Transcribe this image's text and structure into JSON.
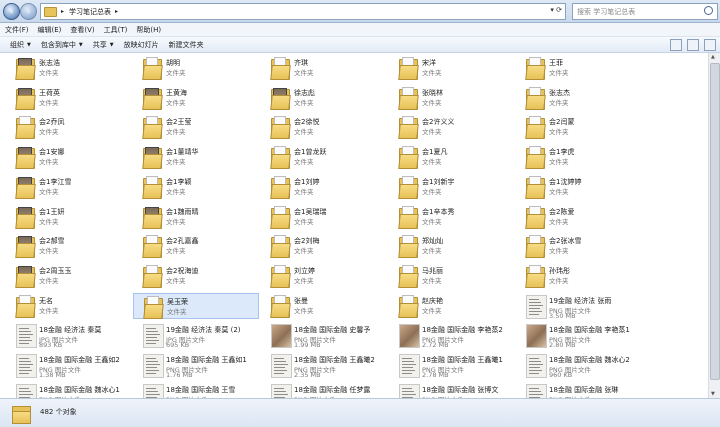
{
  "address": {
    "path": [
      "学习笔记总表"
    ],
    "search_placeholder": "搜索 学习笔记总表"
  },
  "menu": [
    "文件(F)",
    "编辑(E)",
    "查看(V)",
    "工具(T)",
    "帮助(H)"
  ],
  "toolbar": [
    "组织",
    "包含到库中",
    "共享",
    "放映幻灯片",
    "新建文件夹"
  ],
  "toolbar_dropdowns": [
    true,
    true,
    true,
    false,
    false
  ],
  "folder_type_label": "文件夹",
  "items": [
    {
      "name": "张志浩",
      "type": "文件夹",
      "kind": "folder-pic"
    },
    {
      "name": "胡明",
      "type": "文件夹",
      "kind": "folder"
    },
    {
      "name": "齐琪",
      "type": "文件夹",
      "kind": "folder"
    },
    {
      "name": "宋洋",
      "type": "文件夹",
      "kind": "folder"
    },
    {
      "name": "王菲",
      "type": "文件夹",
      "kind": "folder"
    },
    {
      "name": "王荷英",
      "type": "文件夹",
      "kind": "folder-pic"
    },
    {
      "name": "王黄海",
      "type": "文件夹",
      "kind": "folder-pic"
    },
    {
      "name": "徐志彪",
      "type": "文件夹",
      "kind": "folder-pic"
    },
    {
      "name": "张晓林",
      "type": "文件夹",
      "kind": "folder"
    },
    {
      "name": "张志杰",
      "type": "文件夹",
      "kind": "folder"
    },
    {
      "name": "会2乔凤",
      "type": "文件夹",
      "kind": "folder"
    },
    {
      "name": "会2王莹",
      "type": "文件夹",
      "kind": "folder"
    },
    {
      "name": "会2徐悦",
      "type": "文件夹",
      "kind": "folder"
    },
    {
      "name": "会2许义义",
      "type": "文件夹",
      "kind": "folder"
    },
    {
      "name": "会2闫蒙",
      "type": "文件夹",
      "kind": "folder"
    },
    {
      "name": "会1安娜",
      "type": "文件夹",
      "kind": "folder-pic"
    },
    {
      "name": "会1董靖华",
      "type": "文件夹",
      "kind": "folder-pic"
    },
    {
      "name": "会1曾龙跃",
      "type": "文件夹",
      "kind": "folder"
    },
    {
      "name": "会1夏凡",
      "type": "文件夹",
      "kind": "folder"
    },
    {
      "name": "会1李虎",
      "type": "文件夹",
      "kind": "folder"
    },
    {
      "name": "会1李江雪",
      "type": "文件夹",
      "kind": "folder-pic"
    },
    {
      "name": "会1李颖",
      "type": "文件夹",
      "kind": "folder"
    },
    {
      "name": "会1刘婷",
      "type": "文件夹",
      "kind": "folder"
    },
    {
      "name": "会1刘新宇",
      "type": "文件夹",
      "kind": "folder"
    },
    {
      "name": "会1沈婷婷",
      "type": "文件夹",
      "kind": "folder"
    },
    {
      "name": "会1王妍",
      "type": "文件夹",
      "kind": "folder-pic"
    },
    {
      "name": "会1魏雨晴",
      "type": "文件夹",
      "kind": "folder-pic"
    },
    {
      "name": "会1吴瑞瑞",
      "type": "文件夹",
      "kind": "folder"
    },
    {
      "name": "会1辛本秀",
      "type": "文件夹",
      "kind": "folder"
    },
    {
      "name": "会2陈爱",
      "type": "文件夹",
      "kind": "folder"
    },
    {
      "name": "会2郝雪",
      "type": "文件夹",
      "kind": "folder-pic"
    },
    {
      "name": "会2孔嘉鑫",
      "type": "文件夹",
      "kind": "folder"
    },
    {
      "name": "会2刘梅",
      "type": "文件夹",
      "kind": "folder"
    },
    {
      "name": "郑灿灿",
      "type": "文件夹",
      "kind": "folder"
    },
    {
      "name": "会2张冰雪",
      "type": "文件夹",
      "kind": "folder"
    },
    {
      "name": "会2周玉玉",
      "type": "文件夹",
      "kind": "folder-pic"
    },
    {
      "name": "会2祝海迪",
      "type": "文件夹",
      "kind": "folder"
    },
    {
      "name": "刘立婷",
      "type": "文件夹",
      "kind": "folder"
    },
    {
      "name": "马兆丽",
      "type": "文件夹",
      "kind": "folder"
    },
    {
      "name": "孙玮彤",
      "type": "文件夹",
      "kind": "folder"
    },
    {
      "name": "无名",
      "type": "文件夹",
      "kind": "folder"
    },
    {
      "name": "吴玉荣",
      "type": "文件夹",
      "kind": "folder",
      "selected": true
    },
    {
      "name": "张曼",
      "type": "文件夹",
      "kind": "folder"
    },
    {
      "name": "赵庆艳",
      "type": "文件夹",
      "kind": "folder"
    },
    {
      "name": "19金融 经济法 张雨",
      "type": "PNG 图片文件",
      "size": "3.50 MB",
      "kind": "image"
    },
    {
      "name": "18金融 经济法 秦莫",
      "type": "JPG 图片文件",
      "size": "893 KB",
      "kind": "image"
    },
    {
      "name": "19金融 经济法 秦莫 (2)",
      "type": "JPG 图片文件",
      "size": "695 KB",
      "kind": "image"
    },
    {
      "name": "18金融 国际金融 史馨予",
      "type": "PNG 图片文件",
      "size": "1.99 MB",
      "kind": "photo"
    },
    {
      "name": "18金融 国际金融 李艳蒸2",
      "type": "PNG 图片文件",
      "size": "2.72 MB",
      "kind": "photo"
    },
    {
      "name": "18金融 国际金融 李艳蒸1",
      "type": "PNG 图片文件",
      "size": "2.80 MB",
      "kind": "photo"
    },
    {
      "name": "18金融 国际金融 王鑫如2",
      "type": "PNG 图片文件",
      "size": "1.38 MB",
      "kind": "image"
    },
    {
      "name": "18金融 国际金融 王鑫如1",
      "type": "PNG 图片文件",
      "size": "1.76 MB",
      "kind": "image"
    },
    {
      "name": "18金融 国际金融 王鑫曦2",
      "type": "PNG 图片文件",
      "size": "2.35 MB",
      "kind": "image"
    },
    {
      "name": "18金融 国际金融 王鑫曦1",
      "type": "PNG 图片文件",
      "size": "2.78 MB",
      "kind": "image"
    },
    {
      "name": "18金融 国际金融 魏冰心2",
      "type": "PNG 图片文件",
      "size": "960 KB",
      "kind": "image"
    },
    {
      "name": "18金融 国际金融 魏冰心1",
      "type": "PNG 图片文件",
      "size": "910 KB",
      "kind": "image"
    },
    {
      "name": "18金融 国际金融 王雪",
      "type": "PNG 图片文件",
      "size": "1.81 MB",
      "kind": "image"
    },
    {
      "name": "18金融 国际金融 任梦露",
      "type": "PNG 图片文件",
      "size": "2.33 MB",
      "kind": "image"
    },
    {
      "name": "18金融 国际金融 张博文",
      "type": "PNG 图片文件",
      "size": "1.80 MB",
      "kind": "image"
    },
    {
      "name": "18金融 国际金融 张琳",
      "type": "PNG 图片文件",
      "size": "1.44 MB",
      "kind": "image"
    }
  ],
  "status": {
    "count_text": "482 个对象"
  }
}
